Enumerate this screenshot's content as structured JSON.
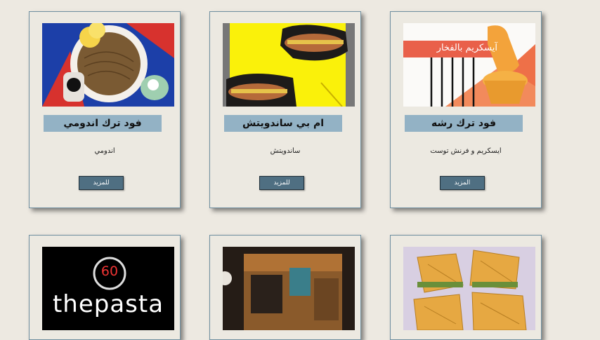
{
  "cards": [
    {
      "title": "فود ترك رشه",
      "desc": "ايسكريم و فرنش توست",
      "button": "المزيد",
      "image_text": "آيسكريم بالفخار"
    },
    {
      "title": "ام بي ساندويتش",
      "desc": "ساندويتش",
      "button": "للمزيد"
    },
    {
      "title": "فود ترك اندومي",
      "desc": "اندومي",
      "button": "للمزيد"
    },
    {
      "logo_number": "60",
      "logo_text": "thepasta"
    }
  ]
}
